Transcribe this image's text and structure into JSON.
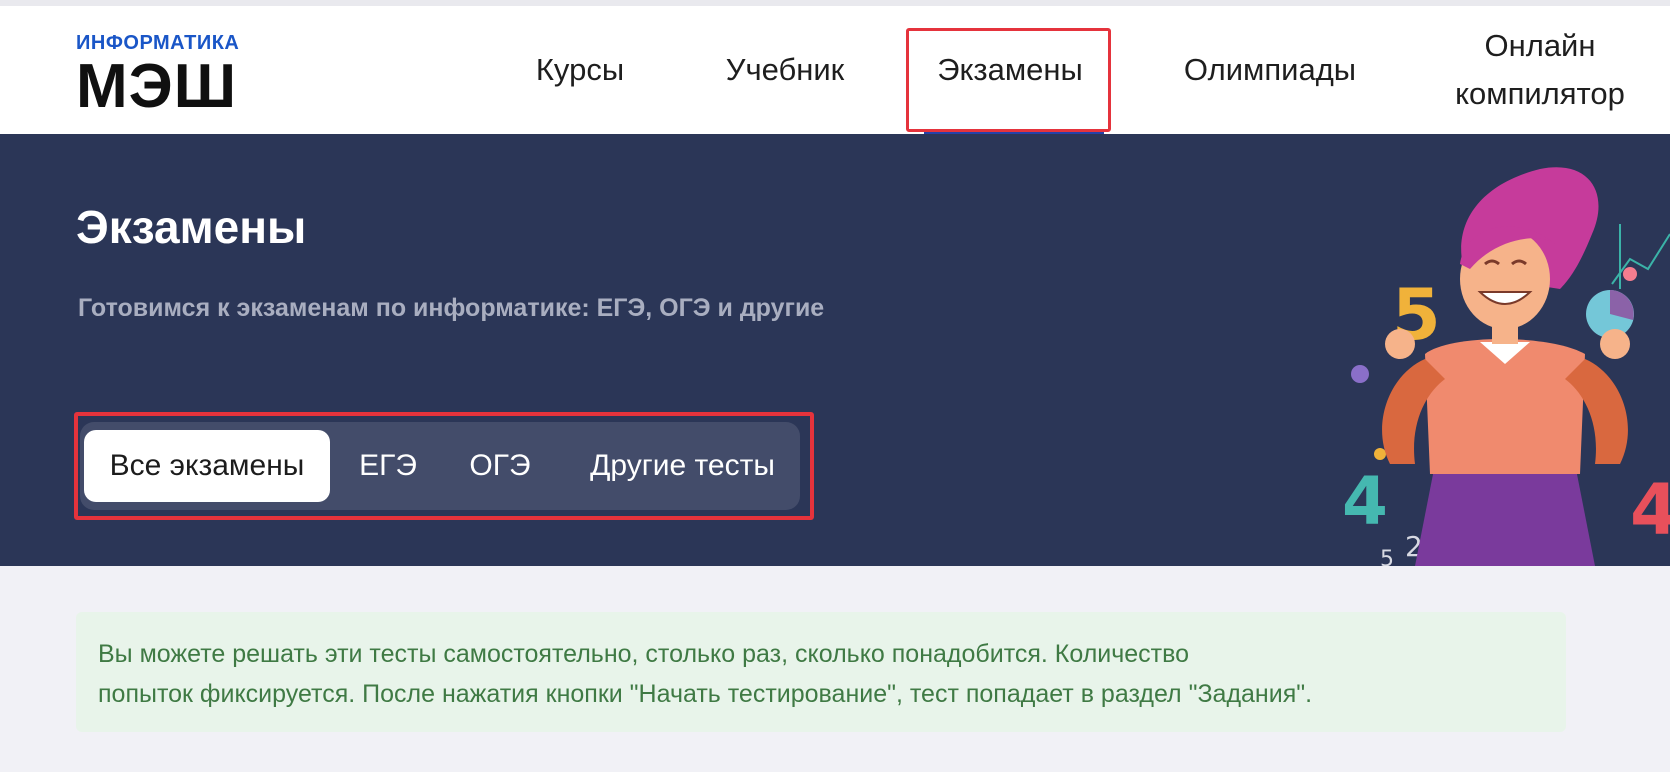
{
  "header": {
    "logo_small": "ИНФОРМАТИКА",
    "logo_big": "МЭШ",
    "nav": {
      "courses": "Курсы",
      "textbook": "Учебник",
      "exams": "Экзамены",
      "olympiads": "Олимпиады",
      "compiler_line1": "Онлайн",
      "compiler_line2": "компилятор"
    },
    "active_item": "exams"
  },
  "hero": {
    "title": "Экзамены",
    "subtitle": "Готовимся к экзаменам по информатике: ЕГЭ, ОГЭ и другие",
    "tabs": {
      "all": "Все экзамены",
      "ege": "ЕГЭ",
      "oge": "ОГЭ",
      "other": "Другие тесты"
    },
    "selected_tab": "all"
  },
  "notice": {
    "line1": "Вы можете решать эти тесты самостоятельно, столько раз, сколько понадобится. Количество",
    "line2": "попыток фиксируется. После нажатия кнопки \"Начать тестирование\", тест попадает в раздел \"Задания\"."
  },
  "colors": {
    "hero_bg": "#2b3657",
    "accent_blue": "#1a56c7",
    "highlight_red": "#e5333c",
    "notice_bg": "#e8f4ea",
    "notice_text": "#3f7a44"
  },
  "illustration": {
    "name": "girl-with-numbers-illustration"
  }
}
